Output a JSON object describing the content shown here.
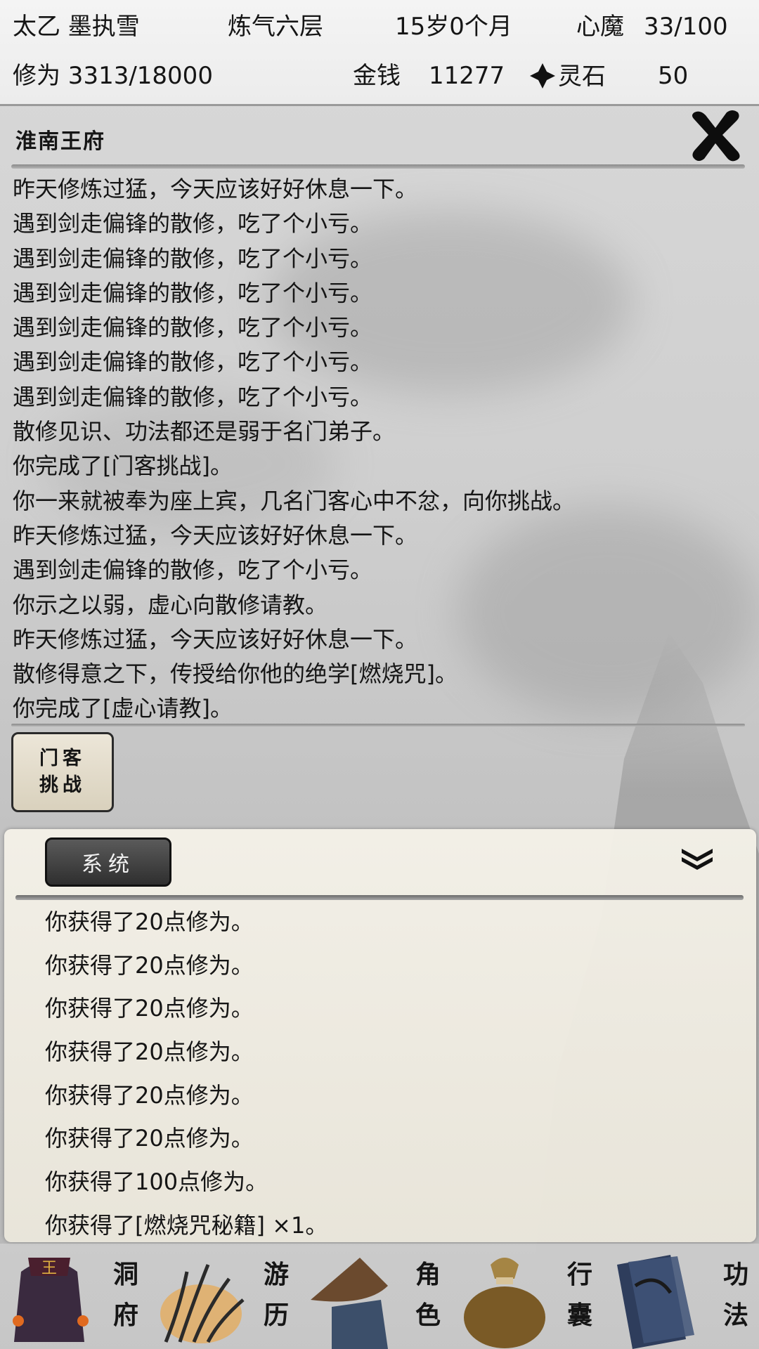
{
  "header": {
    "name": "太乙 墨执雪",
    "realm": "炼气六层",
    "age": "15岁0个月",
    "demon_label": "心魔",
    "demon_value": "33/100",
    "cultivation": "修为 3313/18000",
    "money_label": "金钱",
    "money_value": "11277",
    "stone_label": "灵石",
    "stone_value": "50",
    "stone_icon": "spirit-stone-icon"
  },
  "location": {
    "title": "淮南王府",
    "close_icon": "close-icon"
  },
  "event_log": [
    "昨天修炼过猛，今天应该好好休息一下。",
    "遇到剑走偏锋的散修，吃了个小亏。",
    "遇到剑走偏锋的散修，吃了个小亏。",
    "遇到剑走偏锋的散修，吃了个小亏。",
    "遇到剑走偏锋的散修，吃了个小亏。",
    "遇到剑走偏锋的散修，吃了个小亏。",
    "遇到剑走偏锋的散修，吃了个小亏。",
    "散修见识、功法都还是弱于名门弟子。",
    "你完成了[门客挑战]。",
    "你一来就被奉为座上宾，几名门客心中不忿，向你挑战。",
    "昨天修炼过猛，今天应该好好休息一下。",
    "遇到剑走偏锋的散修，吃了个小亏。",
    "你示之以弱，虚心向散修请教。",
    "昨天修炼过猛，今天应该好好休息一下。",
    "散修得意之下，传授给你他的绝学[燃烧咒]。",
    "你完成了[虚心请教]。"
  ],
  "action_button": {
    "line1": "门客",
    "line2": "挑战"
  },
  "system": {
    "tab_label": "系统",
    "collapse_icon": "double-chevron-down-icon",
    "messages": [
      "你获得了20点修为。",
      "你获得了20点修为。",
      "你获得了20点修为。",
      "你获得了20点修为。",
      "你获得了20点修为。",
      "你获得了20点修为。",
      "你获得了100点修为。",
      "你获得了[燃烧咒秘籍] ×1。"
    ]
  },
  "nav": [
    {
      "line1": "洞",
      "line2": "府",
      "icon": "cave-residence-icon"
    },
    {
      "line1": "游",
      "line2": "历",
      "icon": "travel-grass-icon"
    },
    {
      "line1": "角",
      "line2": "色",
      "icon": "character-hat-icon"
    },
    {
      "line1": "行",
      "line2": "囊",
      "icon": "bag-icon"
    },
    {
      "line1": "功",
      "line2": "法",
      "icon": "scripture-book-icon"
    }
  ]
}
